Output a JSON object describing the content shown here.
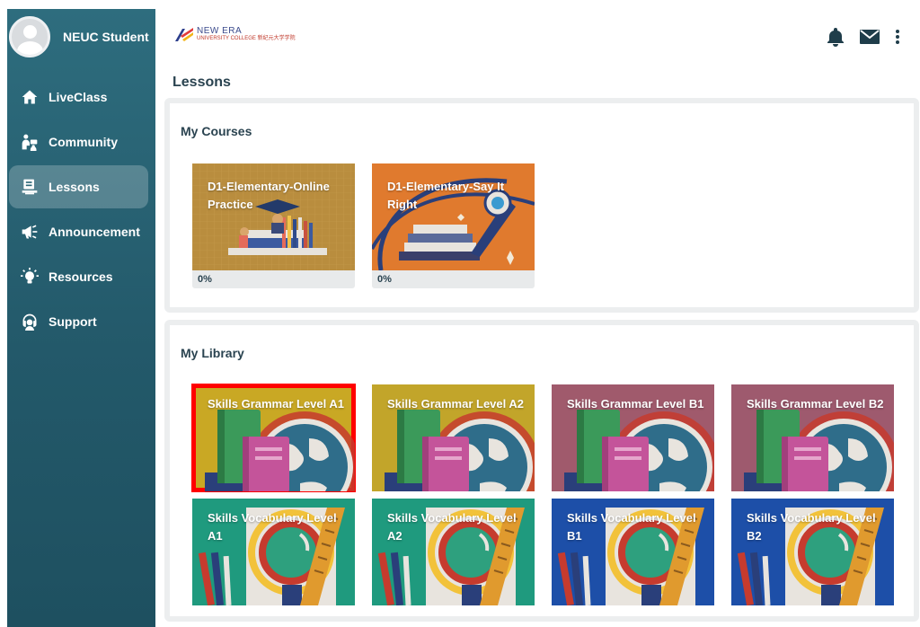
{
  "profile": {
    "name": "NEUC Student"
  },
  "nav": [
    {
      "label": "LiveClass",
      "icon": "home-icon",
      "active": false
    },
    {
      "label": "Community",
      "icon": "community-icon",
      "active": false
    },
    {
      "label": "Lessons",
      "icon": "lessons-icon",
      "active": true
    },
    {
      "label": "Announcement",
      "icon": "megaphone-icon",
      "active": false
    },
    {
      "label": "Resources",
      "icon": "lightbulb-icon",
      "active": false
    },
    {
      "label": "Support",
      "icon": "support-icon",
      "active": false
    }
  ],
  "logo": {
    "line1": "NEW ERA",
    "line2": "UNIVERSITY COLLEGE 新纪元大学学院"
  },
  "header": {
    "icons": [
      "bell-icon",
      "mail-icon",
      "more-vertical-icon"
    ]
  },
  "page": {
    "title": "Lessons"
  },
  "courses": {
    "title": "My Courses",
    "items": [
      {
        "title": "D1-Elementary-Online Practice",
        "progress": "0%"
      },
      {
        "title": "D1-Elementary-Say It Right",
        "progress": "0%"
      }
    ]
  },
  "library": {
    "title": "My Library",
    "items": [
      {
        "title": "Skills Grammar Level A1",
        "selected": true
      },
      {
        "title": "Skills Grammar Level A2",
        "selected": false
      },
      {
        "title": "Skills Grammar Level B1",
        "selected": false
      },
      {
        "title": "Skills Grammar Level B2",
        "selected": false
      },
      {
        "title": "Skills Vocabulary Level A1",
        "selected": false
      },
      {
        "title": "Skills Vocabulary Level A2",
        "selected": false
      },
      {
        "title": "Skills Vocabulary Level B1",
        "selected": false
      },
      {
        "title": "Skills Vocabulary Level B2",
        "selected": false
      }
    ]
  },
  "colors": {
    "sidebar": "#2e6d7e",
    "selection": "#ff0000",
    "grammar_a1": "#c9a824",
    "grammar_a2": "#c2a52a",
    "grammar_b1": "#a05a6c",
    "grammar_b2": "#9e5a6e",
    "vocab_a1": "#1f9a7e",
    "vocab_a2": "#1f9a7e",
    "vocab_b1": "#1d4fa8",
    "vocab_b2": "#1d4fa8"
  }
}
